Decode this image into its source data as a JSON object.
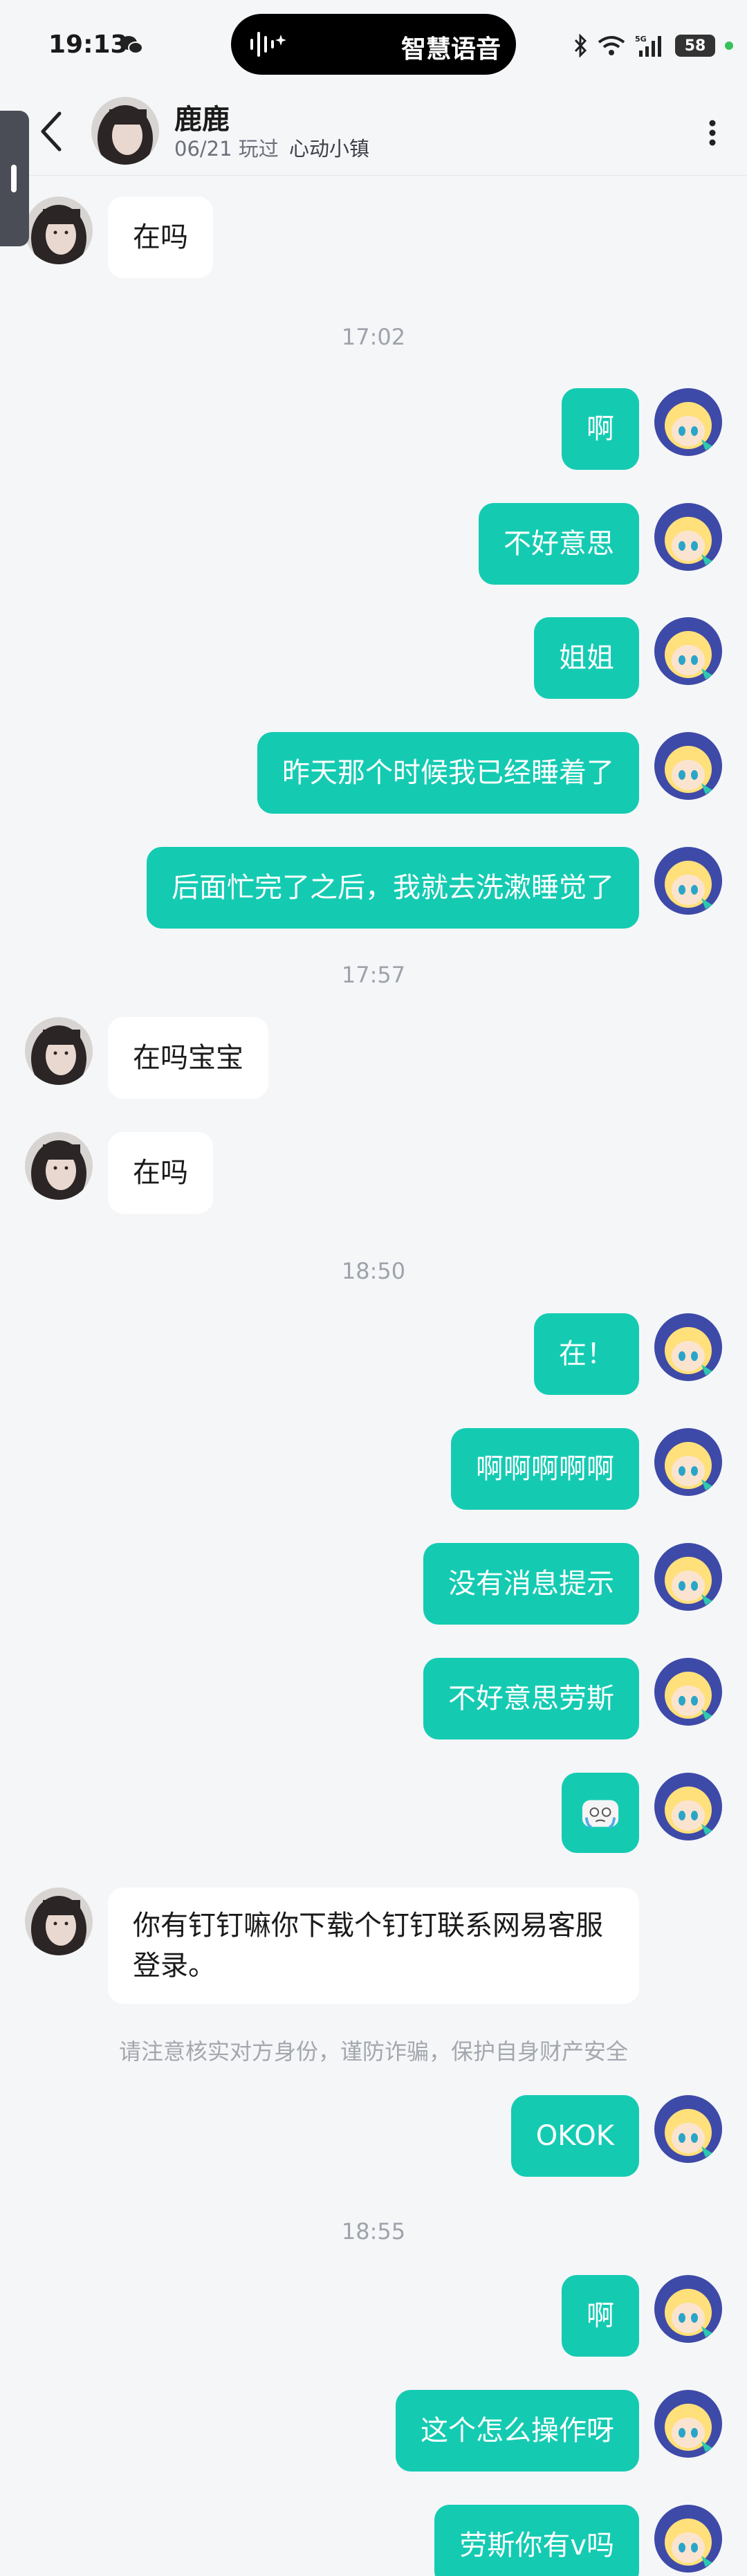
{
  "status_bar": {
    "time": "19:13",
    "island_label": "智慧语音",
    "battery": "58",
    "network": "5G"
  },
  "header": {
    "contact_name": "鹿鹿",
    "date": "06/21",
    "played_text": "玩过",
    "game": "心动小镇"
  },
  "timestamps": [
    "17:02",
    "17:57",
    "18:50",
    "18:55"
  ],
  "safety_notice": "请注意核实对方身份，谨防诈骗，保护自身财产安全",
  "messages": [
    {
      "from": "contact",
      "text": "在吗"
    },
    {
      "from": "me",
      "text": "啊"
    },
    {
      "from": "me",
      "text": "不好意思"
    },
    {
      "from": "me",
      "text": "姐姐"
    },
    {
      "from": "me",
      "text": "昨天那个时候我已经睡着了"
    },
    {
      "from": "me",
      "text": "后面忙完了之后，我就去洗漱睡觉了"
    },
    {
      "from": "contact",
      "text": "在吗宝宝"
    },
    {
      "from": "contact",
      "text": "在吗"
    },
    {
      "from": "me",
      "text": "在！"
    },
    {
      "from": "me",
      "text": "啊啊啊啊啊"
    },
    {
      "from": "me",
      "text": "没有消息提示"
    },
    {
      "from": "me",
      "text": "不好意思劳斯"
    },
    {
      "from": "me",
      "text": "",
      "sticker": "crying-face-emoji"
    },
    {
      "from": "contact",
      "text": "你有钉钉嘛你下载个钉钉联系网易客服登录。"
    },
    {
      "from": "me",
      "text": "OKOK"
    },
    {
      "from": "me",
      "text": "啊"
    },
    {
      "from": "me",
      "text": "这个怎么操作呀"
    },
    {
      "from": "me",
      "text": "劳斯你有v吗"
    }
  ],
  "colors": {
    "outgoing_bubble": "#14cbb2",
    "incoming_bubble": "#ffffff",
    "background": "#f5f6f8"
  }
}
